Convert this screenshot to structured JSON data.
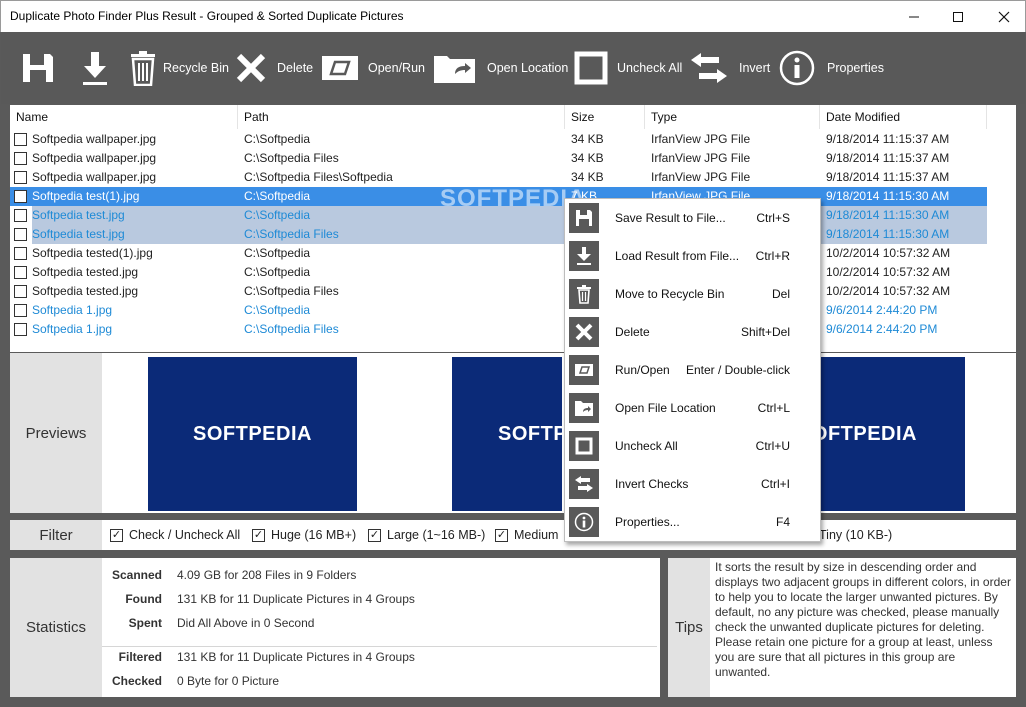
{
  "window": {
    "title": "Duplicate Photo Finder Plus Result - Grouped & Sorted Duplicate Pictures"
  },
  "toolbar": {
    "save_icon": "save-floppy-icon",
    "load_icon": "download-arrow-icon",
    "recycle_label": "Recycle Bin",
    "delete_label": "Delete",
    "open_run_label": "Open/Run",
    "open_location_label": "Open Location",
    "uncheck_all_label": "Uncheck All",
    "invert_label": "Invert",
    "properties_label": "Properties"
  },
  "list": {
    "columns": [
      "Name",
      "Path",
      "Size",
      "Type",
      "Date Modified"
    ],
    "rows": [
      {
        "name": "Softpedia wallpaper.jpg",
        "path": "C:\\Softpedia",
        "size": "34 KB",
        "type": "IrfanView JPG File",
        "date": "9/18/2014 11:15:37 AM"
      },
      {
        "name": "Softpedia wallpaper.jpg",
        "path": "C:\\Softpedia Files",
        "size": "34 KB",
        "type": "IrfanView JPG File",
        "date": "9/18/2014 11:15:37 AM"
      },
      {
        "name": "Softpedia wallpaper.jpg",
        "path": "C:\\Softpedia Files\\Softpedia",
        "size": "34 KB",
        "type": "IrfanView JPG File",
        "date": "9/18/2014 11:15:37 AM"
      },
      {
        "name": "Softpedia test(1).jpg",
        "path": "C:\\Softpedia",
        "size": "7 KB",
        "type": "IrfanView JPG File",
        "date": "9/18/2014 11:15:30 AM"
      },
      {
        "name": "Softpedia test.jpg",
        "path": "C:\\Softpedia",
        "size": "",
        "type": "",
        "date": "9/18/2014 11:15:30 AM"
      },
      {
        "name": "Softpedia test.jpg",
        "path": "C:\\Softpedia Files",
        "size": "",
        "type": "",
        "date": "9/18/2014 11:15:30 AM"
      },
      {
        "name": "Softpedia tested(1).jpg",
        "path": "C:\\Softpedia",
        "size": "",
        "type": "",
        "date": "10/2/2014 10:57:32 AM"
      },
      {
        "name": "Softpedia tested.jpg",
        "path": "C:\\Softpedia",
        "size": "",
        "type": "",
        "date": "10/2/2014 10:57:32 AM"
      },
      {
        "name": "Softpedia tested.jpg",
        "path": "C:\\Softpedia Files",
        "size": "",
        "type": "",
        "date": "10/2/2014 10:57:32 AM"
      },
      {
        "name": "Softpedia 1.jpg",
        "path": "C:\\Softpedia",
        "size": "",
        "type": "",
        "date": "9/6/2014 2:44:20 PM"
      },
      {
        "name": "Softpedia 1.jpg",
        "path": "C:\\Softpedia Files",
        "size": "",
        "type": "",
        "date": "9/6/2014 2:44:20 PM"
      }
    ]
  },
  "previews": {
    "label": "Previews",
    "thumb_text": [
      "SOFTPEDIA",
      "SOFTPEDIA",
      "SOFTPEDIA"
    ]
  },
  "filter": {
    "label": "Filter",
    "items": [
      "Check / Uncheck All",
      "Huge (16 MB+)",
      "Large (1~16 MB-)",
      "Medium",
      "Tiny (10 KB-)"
    ]
  },
  "stats": {
    "label": "Statistics",
    "scanned_key": "Scanned",
    "scanned_val": "4.09 GB for 208 Files in 9 Folders",
    "found_key": "Found",
    "found_val": "131 KB for 11 Duplicate Pictures in 4 Groups",
    "spent_key": "Spent",
    "spent_val": "Did All Above in 0 Second",
    "filtered_key": "Filtered",
    "filtered_val": "131 KB for 11 Duplicate Pictures in 4 Groups",
    "checked_key": "Checked",
    "checked_val": "0 Byte for 0 Picture"
  },
  "tips": {
    "label": "Tips",
    "text": "It sorts the result by size in descending order and displays two adjacent groups in different colors, in order to help you to locate the larger unwanted pictures. By default, no any picture was checked, please manually check the unwanted duplicate pictures for deleting. Please retain one picture for a group at least, unless you are sure that all pictures in this group are unwanted."
  },
  "menu": {
    "items": [
      {
        "label": "Save Result to File...",
        "shortcut": "Ctrl+S",
        "icon": "save-floppy-icon"
      },
      {
        "label": "Load Result from File...",
        "shortcut": "Ctrl+R",
        "icon": "download-arrow-icon"
      },
      {
        "label": "Move to Recycle Bin",
        "shortcut": "Del",
        "icon": "trash-icon"
      },
      {
        "label": "Delete",
        "shortcut": "Shift+Del",
        "icon": "x-icon"
      },
      {
        "label": "Run/Open",
        "shortcut": "Enter / Double-click",
        "icon": "run-icon"
      },
      {
        "label": "Open File Location",
        "shortcut": "Ctrl+L",
        "icon": "folder-open-icon"
      },
      {
        "label": "Uncheck All",
        "shortcut": "Ctrl+U",
        "icon": "square-icon"
      },
      {
        "label": "Invert Checks",
        "shortcut": "Ctrl+I",
        "icon": "swap-arrows-icon"
      },
      {
        "label": "Properties...",
        "shortcut": "F4",
        "icon": "info-icon"
      }
    ]
  },
  "watermark": "SOFTPEDIA",
  "colors": {
    "toolbar": "#595959",
    "selection": "#3a8ee6",
    "group_highlight": "#b9c9df",
    "link_blue": "#1e8ad6",
    "preview_navy": "#0b2a78"
  }
}
